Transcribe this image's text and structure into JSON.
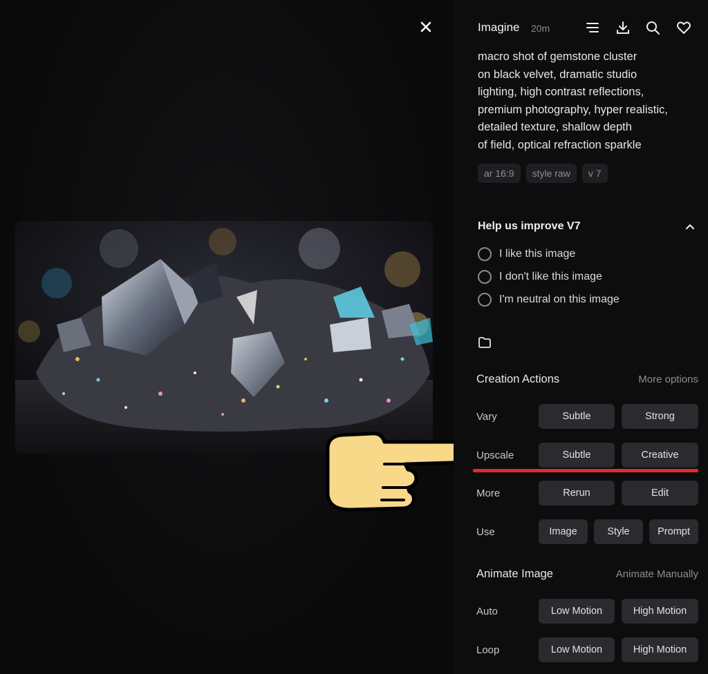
{
  "header": {
    "title": "Imagine",
    "time": "20m"
  },
  "prompt": {
    "text": "macro shot of gemstone cluster\non black velvet, dramatic studio\nlighting, high contrast reflections,\npremium photography, hyper realistic,\ndetailed texture, shallow depth\nof field, optical refraction sparkle"
  },
  "tags": [
    "ar 16:9",
    "style raw",
    "v 7"
  ],
  "feedback": {
    "title": "Help us improve V7",
    "options": [
      "I like this image",
      "I don't like this image",
      "I'm neutral on this image"
    ]
  },
  "creation": {
    "title": "Creation Actions",
    "more_options": "More options",
    "rows": [
      {
        "label": "Vary",
        "buttons": [
          "Subtle",
          "Strong"
        ]
      },
      {
        "label": "Upscale",
        "buttons": [
          "Subtle",
          "Creative"
        ]
      },
      {
        "label": "More",
        "buttons": [
          "Rerun",
          "Edit"
        ]
      },
      {
        "label": "Use",
        "buttons": [
          "Image",
          "Style",
          "Prompt"
        ]
      }
    ]
  },
  "animate": {
    "title": "Animate Image",
    "manual": "Animate Manually",
    "rows": [
      {
        "label": "Auto",
        "buttons": [
          "Low Motion",
          "High Motion"
        ]
      },
      {
        "label": "Loop",
        "buttons": [
          "Low Motion",
          "High Motion"
        ]
      }
    ]
  },
  "icons": {
    "close": "close-icon",
    "menu": "menu-lines-icon",
    "download": "download-icon",
    "search": "search-icon",
    "favorite": "heart-icon",
    "collapse": "chevron-up-icon",
    "folder": "folder-icon",
    "pointer": "pointing-hand-icon"
  },
  "colors": {
    "background": "#0b0b0c",
    "button": "#2a2a2f",
    "highlight_underline": "#e32b2b",
    "hand_fill": "#f8d98a"
  }
}
